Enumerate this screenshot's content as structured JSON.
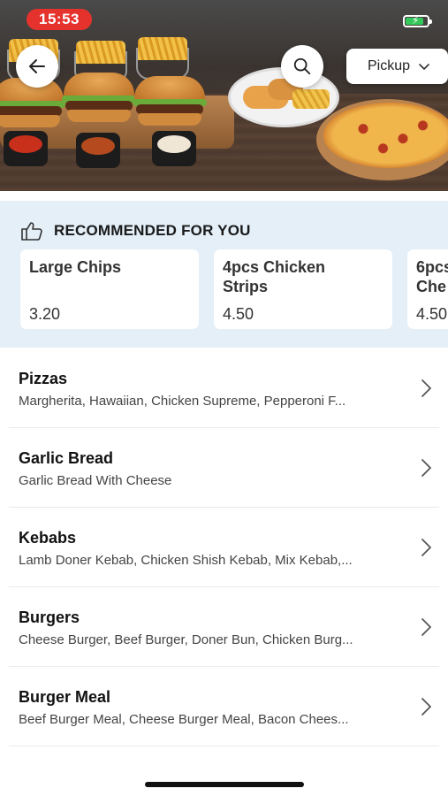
{
  "status_bar": {
    "time": "15:53",
    "battery_level": 0.85,
    "charging": true
  },
  "header": {
    "back_icon": "arrow-left-icon",
    "search_icon": "search-icon",
    "order_mode": "Pickup",
    "order_mode_icon": "chevron-down-icon"
  },
  "recommended": {
    "title": "RECOMMENDED FOR YOU",
    "icon": "thumbs-up-icon",
    "items": [
      {
        "name": "Large Chips",
        "price": "3.20"
      },
      {
        "name": "4pcs Chicken\nStrips",
        "price": "4.50"
      },
      {
        "name": "6pcs\nChe",
        "price": "4.50"
      }
    ]
  },
  "menu": {
    "categories": [
      {
        "name": "Pizzas",
        "description": "Margherita, Hawaiian, Chicken Supreme, Pepperoni F..."
      },
      {
        "name": "Garlic Bread",
        "description": "Garlic Bread With Cheese"
      },
      {
        "name": "Kebabs",
        "description": "Lamb Doner Kebab, Chicken Shish Kebab, Mix Kebab,..."
      },
      {
        "name": "Burgers",
        "description": "Cheese Burger, Beef Burger, Doner Bun, Chicken Burg..."
      },
      {
        "name": "Burger Meal",
        "description": "Beef Burger Meal, Cheese Burger Meal, Bacon Chees..."
      }
    ],
    "row_icon": "chevron-right-icon"
  },
  "colors": {
    "accent_red": "#e5322d",
    "reco_bg": "#e4eff8",
    "battery_green": "#34c759"
  }
}
